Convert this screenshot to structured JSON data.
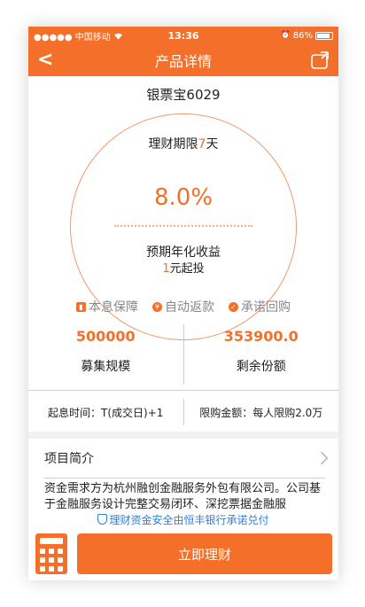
{
  "status_bar": {
    "carrier": "●●●●● 中国移动",
    "time": "13:36",
    "battery": "86%",
    "battery_level": 0.86
  },
  "nav": {
    "title": "产品详情"
  },
  "product": {
    "name": "银票宝6029",
    "term_prefix": "理财期限",
    "term_value": "7",
    "term_unit": "天",
    "rate": "8.0%",
    "rate_label": "预期年化收益",
    "min_value": "1",
    "min_suffix": "元起投"
  },
  "features": [
    {
      "label": "本息保障",
      "icon": "guarantee-icon"
    },
    {
      "label": "自动返款",
      "icon": "auto-refund-icon"
    },
    {
      "label": "承诺回购",
      "icon": "buyback-icon"
    }
  ],
  "stats": {
    "raise_value": "500000",
    "raise_label": "募集规模",
    "remain_value": "353900.0",
    "remain_label": "剩余份额"
  },
  "terms": {
    "start": "起息时间：T(成交日)+1",
    "limit": "限购金额：每人限购2.0万"
  },
  "intro": {
    "title": "项目简介",
    "text": "资金需求方为杭州融创金融服务外包有限公司。公司基于金融服务设计完整交易闭环、深挖票据金融服",
    "notice": "理财资金安全由恒丰银行承诺兑付"
  },
  "cta": {
    "label": "立即理财"
  },
  "colors": {
    "accent": "#f46f29",
    "notice": "#2f7fd9"
  }
}
